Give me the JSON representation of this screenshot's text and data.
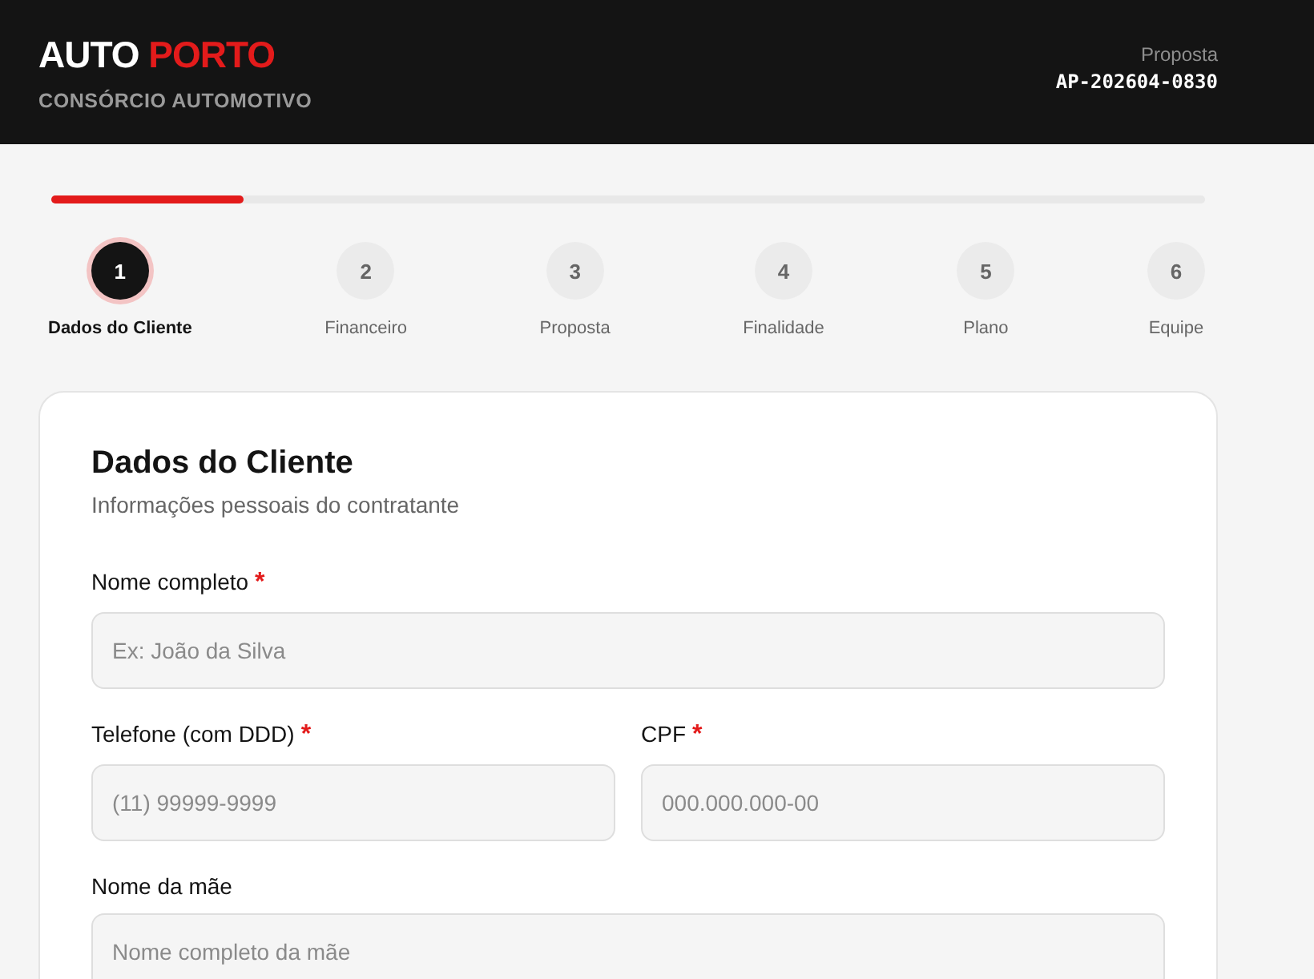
{
  "header": {
    "brand_first": "AUTO",
    "brand_second": "PORTO",
    "subtitle": "CONSÓRCIO AUTOMOTIVO",
    "proposal_label": "Proposta",
    "proposal_code": "AP-202604-0830"
  },
  "progress": {
    "level": 0.167
  },
  "steps": [
    {
      "number": "1",
      "label": "Dados do Cliente",
      "selected": true
    },
    {
      "number": "2",
      "label": "Financeiro",
      "selected": false
    },
    {
      "number": "3",
      "label": "Proposta",
      "selected": false
    },
    {
      "number": "4",
      "label": "Finalidade",
      "selected": false
    },
    {
      "number": "5",
      "label": "Plano",
      "selected": false
    },
    {
      "number": "6",
      "label": "Equipe",
      "selected": false
    }
  ],
  "card": {
    "title": "Dados do Cliente",
    "subtitle": "Informações pessoais do contratante",
    "rows": [
      [
        {
          "label": "Nome completo",
          "required_mark": "*",
          "placeholder": "Ex: João da Silva"
        }
      ],
      [
        {
          "label": "Telefone (com DDD)",
          "required_mark": "*",
          "placeholder": "(11) 99999-9999"
        },
        {
          "label": "CPF",
          "required_mark": "*",
          "placeholder": "000.000.000-00"
        }
      ],
      [
        {
          "label": "Nome da mãe",
          "placeholder": "Nome completo da mãe"
        }
      ]
    ]
  }
}
